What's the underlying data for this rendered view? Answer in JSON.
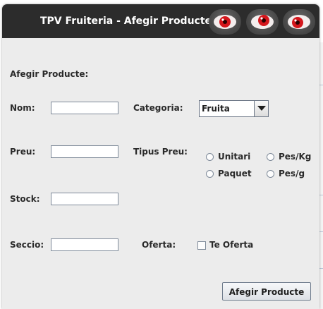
{
  "window": {
    "title": "TPV Fruiteria - Afegir Producte",
    "title_buttons": [
      "eye-button",
      "eye-button",
      "eye-button"
    ]
  },
  "form": {
    "heading": "Afegir Producte:",
    "name_label": "Nom:",
    "name_value": "",
    "category_label": "Categoria:",
    "category_selected": "Fruita",
    "price_label": "Preu:",
    "price_value": "",
    "price_type_label": "Tipus Preu:",
    "price_type_options": [
      {
        "label": "Unitari",
        "checked": false
      },
      {
        "label": "Pes/Kg",
        "checked": false
      },
      {
        "label": "Paquet",
        "checked": false
      },
      {
        "label": "Pes/g",
        "checked": false
      }
    ],
    "stock_label": "Stock:",
    "stock_value": "",
    "section_label": "Seccio:",
    "section_value": "",
    "offer_label": "Oferta:",
    "offer_checkbox_label": "Te Oferta",
    "offer_checked": false,
    "submit_label": "Afegir Producte"
  },
  "colors": {
    "titlebar": "#2c2c2c",
    "window_bg": "#ececec",
    "eye_iris": "#d4161c"
  }
}
